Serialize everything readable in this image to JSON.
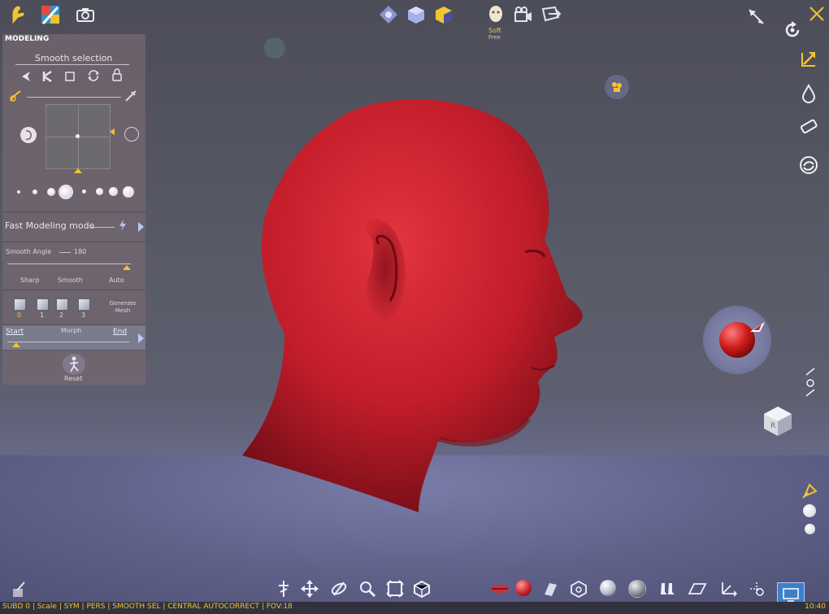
{
  "colors": {
    "accent": "#f4c430",
    "panel": "#76686f",
    "head": "#c81f2c"
  },
  "panel": {
    "title": "MODELING",
    "smooth_selection": "Smooth selection",
    "fast_modeling": "Fast Modeling mode",
    "smooth_angle_label": "Smooth Angle",
    "smooth_angle_value": "180",
    "modes": [
      "Sharp",
      "Smooth",
      "Auto"
    ],
    "subdiv_levels": [
      "0",
      "1",
      "2",
      "3"
    ],
    "generate_mesh": "Generate Mesh",
    "morph_start": "Start",
    "morph_label": "Morph",
    "morph_end": "End",
    "reset": "Reset"
  },
  "top": {
    "mode_label": "Soft",
    "mode_sub": "Free"
  },
  "status": {
    "text": "SUBD 0 | Scale | SYM | PERS | SMOOTH SEL | CENTRAL AUTOCORRECT | FOV:18",
    "time": "10:40"
  }
}
